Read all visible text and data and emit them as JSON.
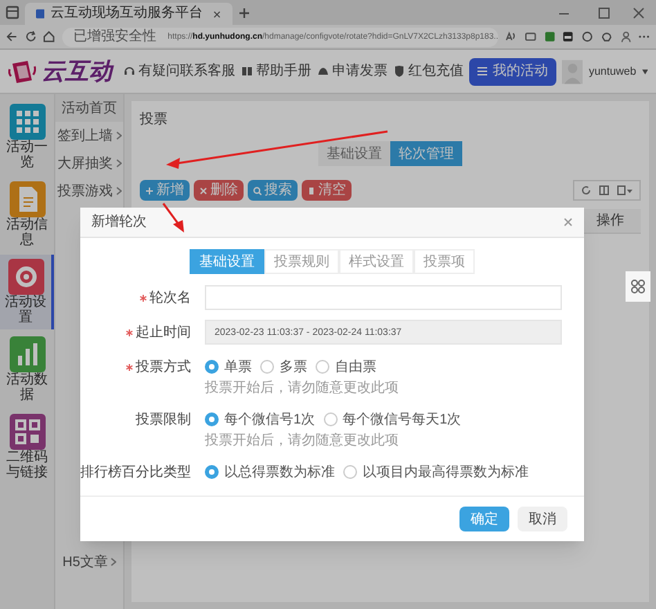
{
  "browser": {
    "tab_title": "云互动现场互动服务平台",
    "security": "已增强安全性",
    "url_scheme": "https://",
    "url_host": "hd.yunhudong.cn",
    "url_path": "/hdmanage/configvote/rotate?hdid=GnLV7X2CLzh3133p8p183..."
  },
  "header": {
    "logo": "云互动",
    "links": [
      {
        "kind": "support",
        "label": "有疑问联系客服"
      },
      {
        "kind": "help",
        "label": "帮助手册"
      },
      {
        "kind": "invoice",
        "label": "申请发票"
      },
      {
        "kind": "redpacket",
        "label": "红包充值"
      }
    ],
    "primary_button": "我的活动",
    "username": "yuntuweb"
  },
  "nav": [
    {
      "kind": "grid",
      "label": "活动一览",
      "selected": false
    },
    {
      "kind": "doc",
      "label": "活动信息",
      "selected": false
    },
    {
      "kind": "gear",
      "label": "活动设置",
      "selected": true
    },
    {
      "kind": "chart",
      "label": "活动数据",
      "selected": false
    },
    {
      "kind": "qr",
      "label": "二维码与链接",
      "selected": false
    }
  ],
  "subnav": [
    {
      "label": "活动首页",
      "has_submenu": false
    },
    {
      "label": "签到上墙",
      "has_submenu": true
    },
    {
      "label": "大屏抽奖",
      "has_submenu": true
    },
    {
      "label": "投票游戏",
      "has_submenu": true
    },
    {
      "label": "H5文章",
      "has_submenu": true
    }
  ],
  "page": {
    "title": "投票",
    "tabs": [
      {
        "label": "基础设置",
        "selected": false
      },
      {
        "label": "轮次管理",
        "selected": true
      }
    ],
    "actions": [
      {
        "kind": "add",
        "label": "新增"
      },
      {
        "kind": "delete",
        "label": "删除"
      },
      {
        "kind": "search",
        "label": "搜索"
      },
      {
        "kind": "clear",
        "label": "清空"
      }
    ],
    "table": {
      "columns": [
        "操作"
      ]
    }
  },
  "modal": {
    "title": "新增轮次",
    "tabs": [
      {
        "label": "基础设置",
        "selected": true
      },
      {
        "label": "投票规则",
        "selected": false
      },
      {
        "label": "样式设置",
        "selected": false
      },
      {
        "label": "投票项",
        "selected": false
      }
    ],
    "fields": [
      {
        "kind": "text",
        "label": "轮次名",
        "required": true,
        "disabled": false
      },
      {
        "kind": "text",
        "label": "起止时间",
        "required": true,
        "disabled": true,
        "value": "2023-02-23 11:03:37 - 2023-02-24 11:03:37"
      },
      {
        "kind": "radio",
        "label": "投票方式",
        "required": true,
        "options": [
          {
            "label": "单票",
            "selected": true
          },
          {
            "label": "多票",
            "selected": false
          },
          {
            "label": "自由票",
            "selected": false
          }
        ],
        "hint": "投票开始后，请勿随意更改此项"
      },
      {
        "kind": "radio",
        "label": "投票限制",
        "required": false,
        "options": [
          {
            "label": "每个微信号1次",
            "selected": true
          },
          {
            "label": "每个微信号每天1次",
            "selected": false
          }
        ],
        "hint": "投票开始后，请勿随意更改此项"
      },
      {
        "kind": "radio",
        "label": "排行榜百分比类型",
        "required": false,
        "options": [
          {
            "label": "以总得票数为标准",
            "selected": true
          },
          {
            "label": "以项目内最高得票数为标准",
            "selected": false
          }
        ]
      }
    ],
    "buttons": [
      {
        "kind": "primary",
        "label": "确定"
      },
      {
        "kind": "default",
        "label": "取消"
      }
    ]
  }
}
